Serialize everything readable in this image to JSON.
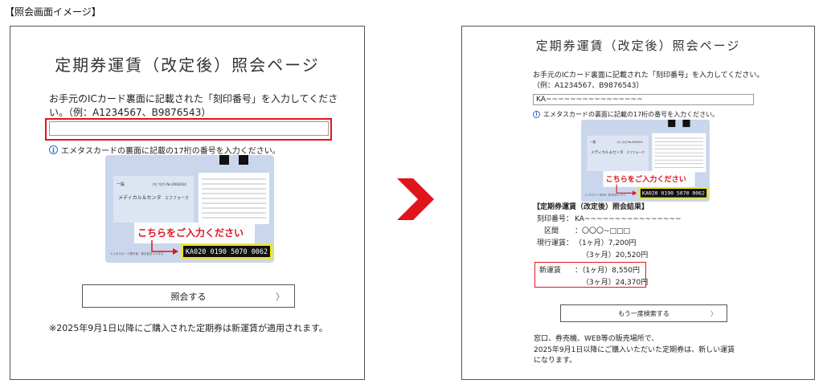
{
  "caption": "【照会画面イメージ】",
  "before": {
    "title": "定期券運賃（改定後）照会ページ",
    "instruction": "お手元のICカード裏面に記載された「刻印番号」を入力してください。（例：A1234567、B9876543）",
    "input_value": "",
    "hint": "エメタスカードの裏面に記載の17桁の番号を入力ください。",
    "card": {
      "prompt": "こちらをご入力ください",
      "number": "KA020 0190 5070 0062",
      "top_label": "一般",
      "card_name": "メディカル＆センタ",
      "card_name2": "エフフォーク"
    },
    "button_label": "照会する",
    "chevron": "〉",
    "note": "※2025年9月1日以降にご購入された定期券は新運賃が適用されます。"
  },
  "after": {
    "title": "定期券運賃（改定後）照会ページ",
    "instruction": "お手元のICカード裏面に記載された「刻印番号」を入力してください。（例：A1234567、B9876543）",
    "input_value": "KA~~~~~~~~~~~~~~~~",
    "hint": "エメタスカードの裏面に記載の17桁の番号を入力ください。",
    "card": {
      "prompt": "こちらをご入力ください",
      "number": "KA020 0190 5070 0062",
      "top_label": "一般",
      "card_name": "メディカル＆センタ",
      "card_name2": "エフフォーク"
    },
    "result": {
      "heading": "【定期券運賃（改定後）照会結果】",
      "serial_label": "刻印番号：",
      "serial_value": "KA~~~~~~~~~~~~~~~~",
      "section_label": "区間",
      "section_value": "：〇〇〇~□□□",
      "current_label": "現行運賃：",
      "current_1m": "（1ヶ月）7,200円",
      "current_3m": "（3ヶ月）20,520円",
      "new_label": "新運賃",
      "new_1m": "：（1ヶ月）8,550円",
      "new_3m": "（3ヶ月）24,370円"
    },
    "button_label": "もう一度検索する",
    "chevron": "〉",
    "note_line1": "窓口、券売機、WEB等の販売場所で、",
    "note_line2": "2025年9月1日以降にご購入いただいた定期券は、新しい運賃",
    "note_line3": "になります。"
  },
  "colors": {
    "highlight_red": "#e0151b",
    "card_blue": "#c9d6ec",
    "number_yellow": "#f5e900",
    "arrow_red": "#e0151b",
    "info_blue": "#2b67c6"
  },
  "icons": [
    "info-icon",
    "chevron-right-icon",
    "arrow-right-icon"
  ]
}
